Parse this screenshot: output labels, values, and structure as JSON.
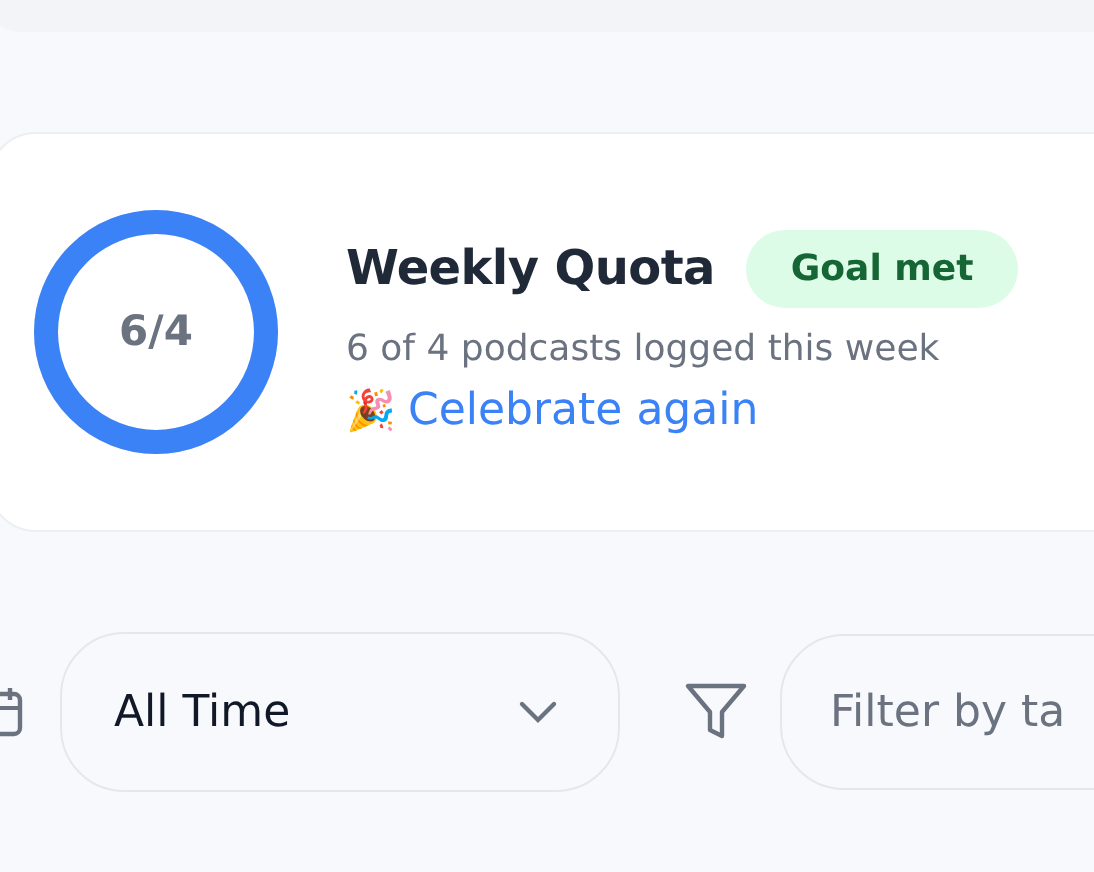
{
  "quota": {
    "ring_label": "6/4",
    "level": 1,
    "title": "Weekly Quota",
    "badge": "Goal met",
    "summary": "6 of 4 podcasts logged this week",
    "emoji": "🎉",
    "link": "Celebrate again"
  },
  "filters": {
    "period": "All Time",
    "tag_placeholder": "Filter by ta"
  }
}
